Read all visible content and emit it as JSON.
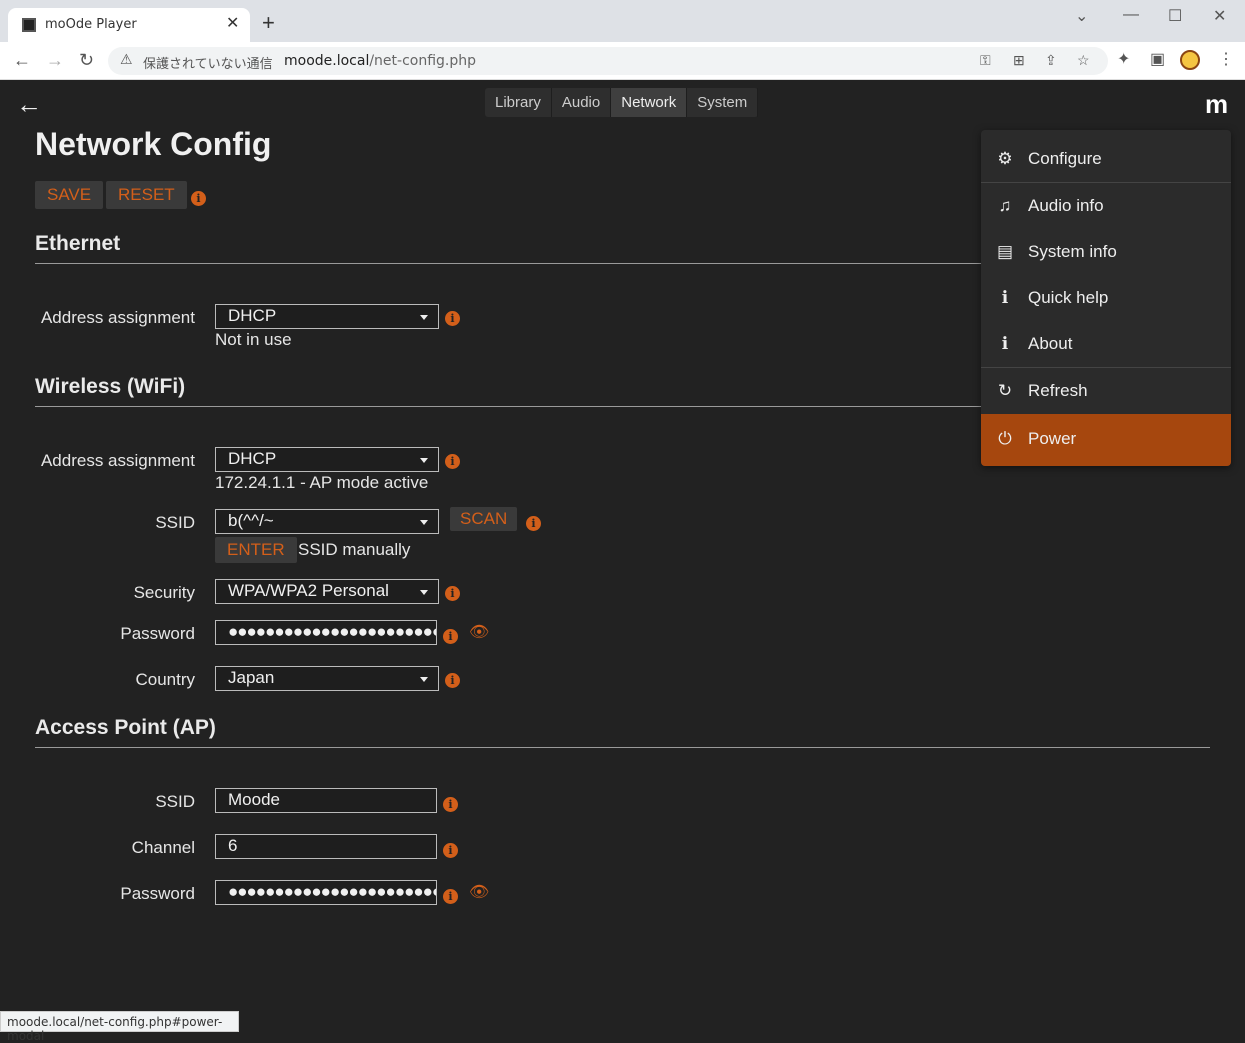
{
  "browser": {
    "tab_title": "moOde Player",
    "security_text": "保護されていない通信",
    "url_host": "moode.local",
    "url_path": "/net-config.php",
    "status_url": "moode.local/net-config.php#power-modal"
  },
  "nav": {
    "tabs": [
      "Library",
      "Audio",
      "Network",
      "System"
    ],
    "active": "Network",
    "logo": "m"
  },
  "page": {
    "title": "Network Config",
    "save_label": "SAVE",
    "reset_label": "RESET"
  },
  "ethernet": {
    "heading": "Ethernet",
    "addr_label": "Address assignment",
    "addr_value": "DHCP",
    "status": "Not in use"
  },
  "wireless": {
    "heading": "Wireless (WiFi)",
    "addr_label": "Address assignment",
    "addr_value": "DHCP",
    "status": "172.24.1.1 - AP mode active",
    "ssid_label": "SSID",
    "ssid_value": "b(^^/~",
    "scan_label": "SCAN",
    "enter_label": "ENTER",
    "enter_suffix": "SSID manually",
    "security_label": "Security",
    "security_value": "WPA/WPA2 Personal",
    "password_label": "Password",
    "password_value": "●●●●●●●●●●●●●●●●●●●●●●●●",
    "country_label": "Country",
    "country_value": "Japan"
  },
  "ap": {
    "heading": "Access Point (AP)",
    "ssid_label": "SSID",
    "ssid_value": "Moode",
    "channel_label": "Channel",
    "channel_value": "6",
    "password_label": "Password",
    "password_value": "●●●●●●●●●●●●●●●●●●●●●●●●"
  },
  "menu": {
    "items": [
      "Configure",
      "Audio info",
      "System info",
      "Quick help",
      "About",
      "Refresh",
      "Power"
    ]
  },
  "colors": {
    "accent": "#d35f1a",
    "power_bg": "#a6470e",
    "page_bg": "#222222"
  }
}
